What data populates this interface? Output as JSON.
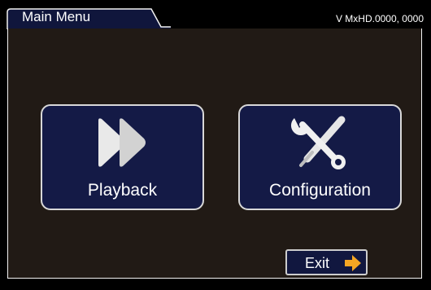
{
  "header": {
    "title": "Main Menu",
    "version": "V MxHD.0000, 0000"
  },
  "menu": {
    "playback": {
      "label": "Playback",
      "icon": "fast-forward-icon"
    },
    "configuration": {
      "label": "Configuration",
      "icon": "tools-icon"
    }
  },
  "footer": {
    "exit_label": "Exit",
    "exit_icon": "arrow-right-icon"
  },
  "colors": {
    "background": "#000000",
    "panel": "#211a15",
    "button": "#141a46",
    "button_border": "#d8d8d8",
    "arrow_accent": "#f5a623",
    "text": "#ffffff"
  }
}
